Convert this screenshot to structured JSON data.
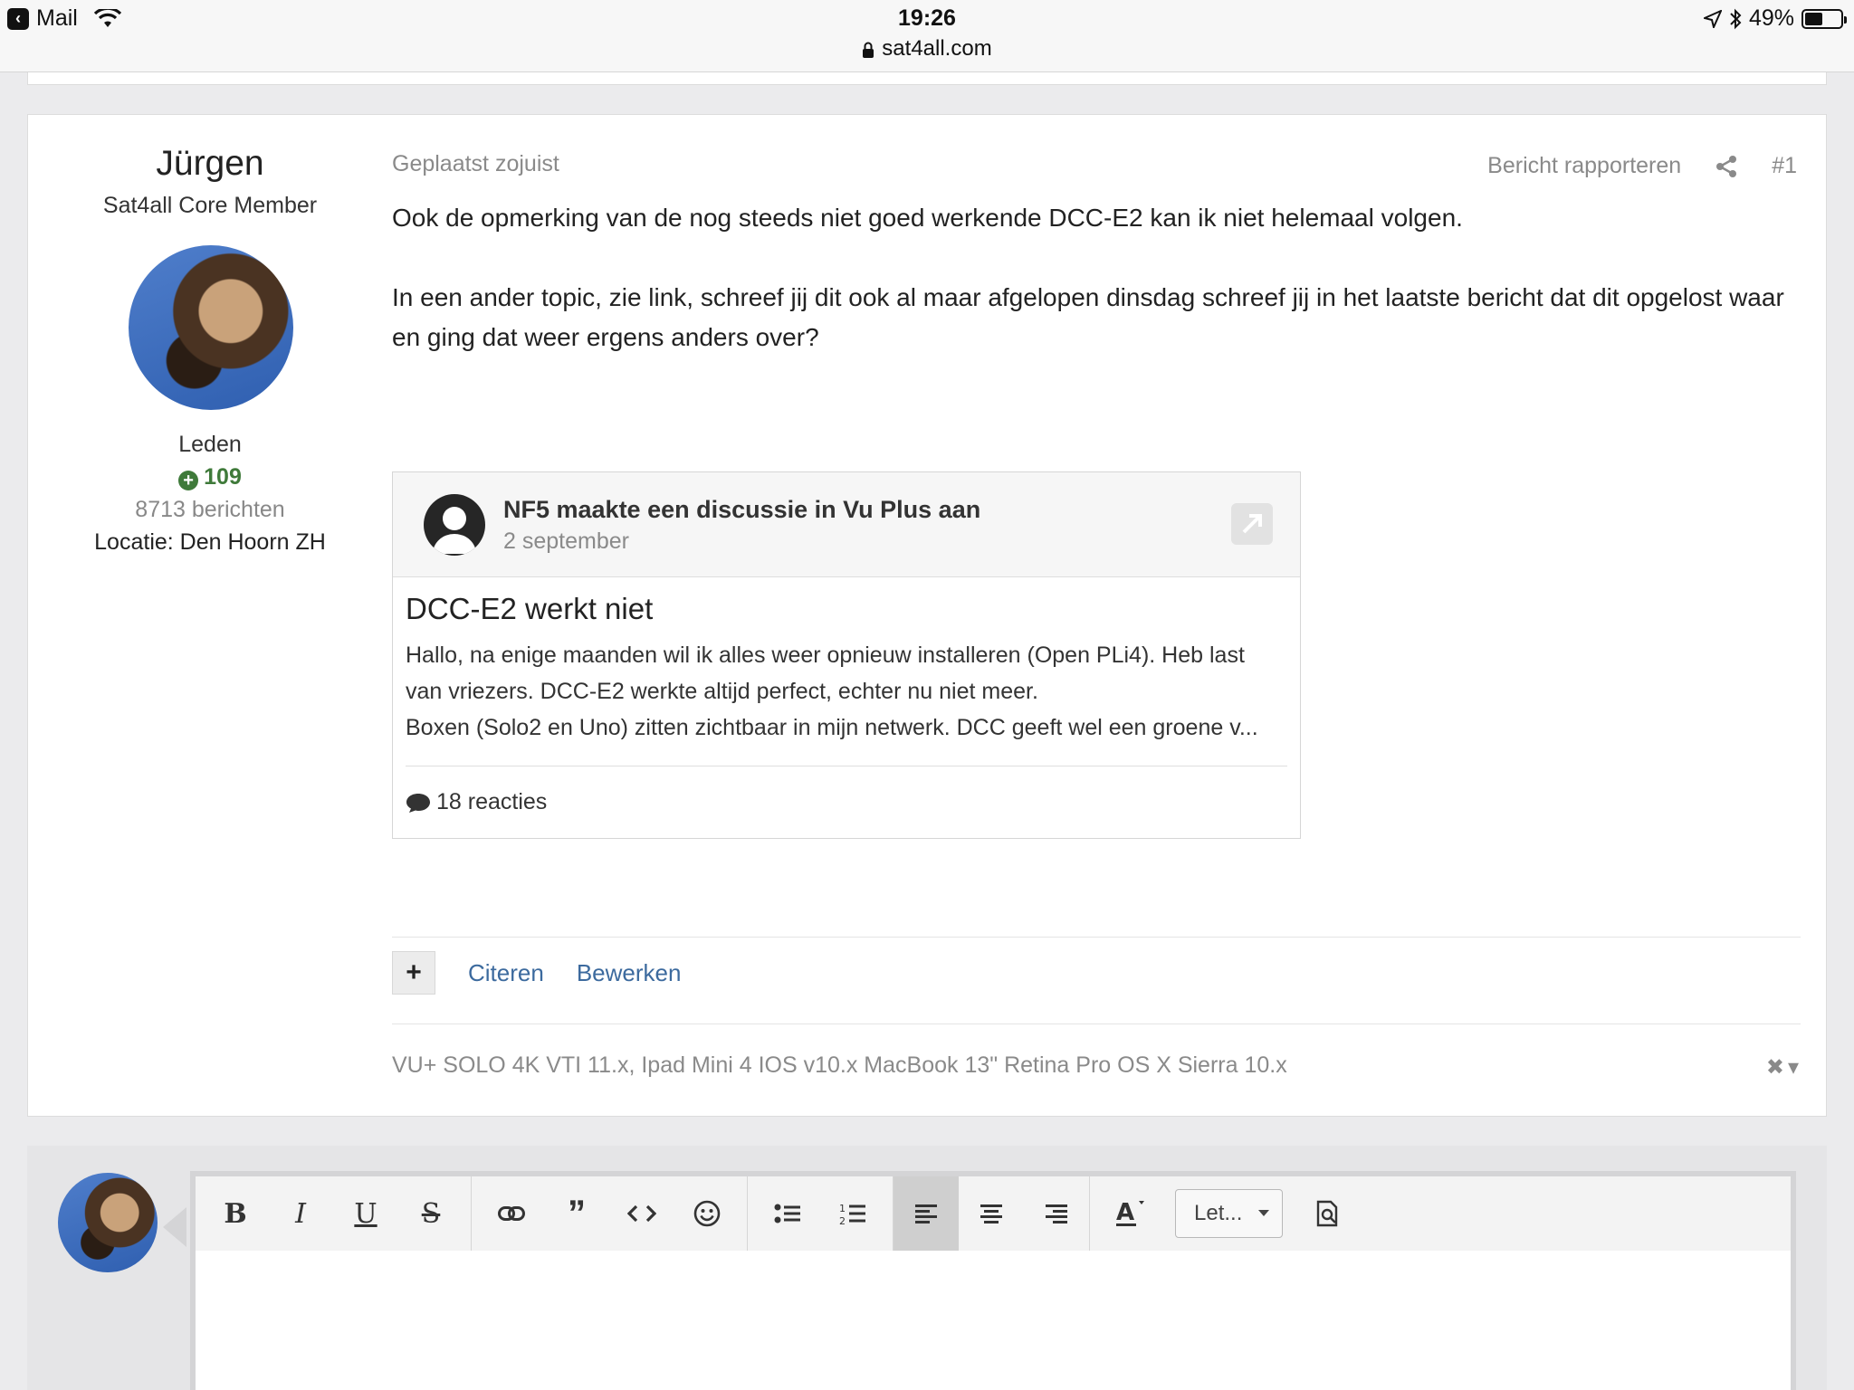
{
  "statusbar": {
    "back_app": "Mail",
    "time": "19:26",
    "url": "sat4all.com",
    "battery": "49%",
    "battery_level": 0.49
  },
  "author": {
    "name": "Jürgen",
    "rank": "Sat4all Core Member",
    "group": "Leden",
    "reputation": "109",
    "post_count": "8713 berichten",
    "location": "Locatie: Den Hoorn ZH"
  },
  "post": {
    "posted": "Geplaatst zojuist",
    "report": "Bericht rapporteren",
    "number": "#1",
    "paragraphs": [
      "Ook de opmerking van de nog steeds niet goed werkende DCC-E2 kan ik niet helemaal volgen.",
      "In een ander topic, zie link, schreef jij dit ook al maar afgelopen dinsdag schreef jij in het laatste bericht dat dit opgelost waar en ging dat weer ergens anders over?"
    ]
  },
  "embed": {
    "title": "NF5 maakte een discussie in Vu Plus aan",
    "date": "2 september",
    "topic": "DCC-E2 werkt niet",
    "excerpt": [
      "Hallo, na enige maanden wil ik alles weer opnieuw installeren (Open PLi4). Heb last",
      "van vriezers. DCC-E2 werkte altijd perfect, echter nu niet meer.",
      "Boxen (Solo2 en Uno) zitten zichtbaar in mijn netwerk. DCC geeft wel een groene v..."
    ],
    "replies": "18 reacties"
  },
  "controls": {
    "plus": "+",
    "quote": "Citeren",
    "edit": "Bewerken"
  },
  "signature": "VU+ SOLO 4K VTI 11.x, Ipad Mini 4 IOS v10.x MacBook 13\" Retina Pro OS X Sierra 10.x",
  "editor": {
    "font_select": "Let..."
  }
}
